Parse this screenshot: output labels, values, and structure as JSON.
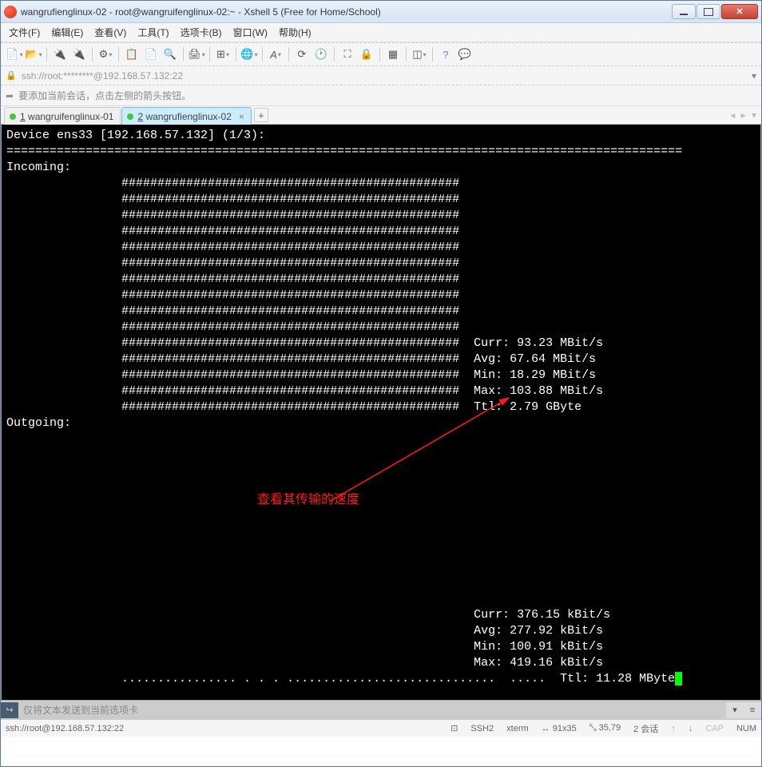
{
  "window": {
    "title": "wangrufienglinux-02 - root@wangruifenglinux-02:~ - Xshell 5 (Free for Home/School)"
  },
  "menu": {
    "file": "文件(F)",
    "edit": "编辑(E)",
    "view": "查看(V)",
    "tools": "工具(T)",
    "tabs": "选项卡(B)",
    "window": "窗口(W)",
    "help": "帮助(H)"
  },
  "address": "ssh://root:********@192.168.57.132:22",
  "hint": "要添加当前会话，点击左侧的箭头按钮。",
  "tabs": [
    {
      "label": "1 wangruifenglinux-01",
      "num": "1",
      "name": "wangruifenglinux-01"
    },
    {
      "label": "2 wangrufienglinux-02",
      "num": "2",
      "name": "wangrufienglinux-02"
    }
  ],
  "terminal": {
    "header": "Device ens33 [192.168.57.132] (1/3):",
    "divider": "==============================================================================================",
    "incoming_label": "Incoming:",
    "outgoing_label": "Outgoing:",
    "hashes": "###############################################",
    "dots": "................ . . . .............................  .....",
    "incoming_stats": {
      "curr": "Curr: 93.23 MBit/s",
      "avg": "Avg: 67.64 MBit/s",
      "min": "Min: 18.29 MBit/s",
      "max": "Max: 103.88 MBit/s",
      "ttl": "Ttl: 2.79 GByte"
    },
    "outgoing_stats": {
      "curr": "Curr: 376.15 kBit/s",
      "avg": "Avg: 277.92 kBit/s",
      "min": "Min: 100.91 kBit/s",
      "max": "Max: 419.16 kBit/s",
      "ttl": "Ttl: 11.28 MByte"
    },
    "annotation": "查看其传输的速度"
  },
  "input_hint": "仅将文本发送到当前选项卡",
  "status": {
    "conn": "ssh://root@192.168.57.132:22",
    "proto": "SSH2",
    "term": "xterm",
    "size": "91x35",
    "cursor": "35,79",
    "sessions": "2 会话",
    "cap": "CAP",
    "num": "NUM"
  },
  "icons": {
    "cursor_size": "⤡",
    "size_arrows": "↔",
    "sessions_up": "↑",
    "sessions_down": "↓",
    "lock": "🔒",
    "ssh": "⊡"
  }
}
